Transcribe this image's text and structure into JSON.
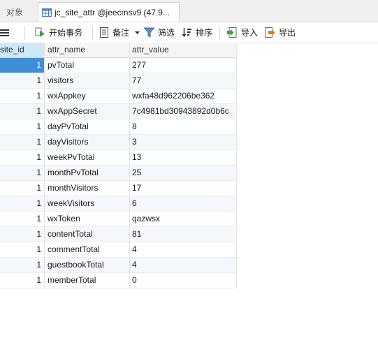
{
  "tabs": {
    "objects_label": "对象",
    "active_label": "jc_site_attr @jeecmsv9 (47.9..."
  },
  "toolbar": {
    "begin_transaction": "开始事务",
    "memo": "备注",
    "filter": "筛选",
    "sort": "排序",
    "import": "导入",
    "export": "导出"
  },
  "table": {
    "columns": [
      "site_id",
      "attr_name",
      "attr_value"
    ],
    "rows": [
      {
        "site_id": "1",
        "attr_name": "pvTotal",
        "attr_value": "277"
      },
      {
        "site_id": "1",
        "attr_name": "visitors",
        "attr_value": "77"
      },
      {
        "site_id": "1",
        "attr_name": "wxAppkey",
        "attr_value": "wxfa48d962206be362"
      },
      {
        "site_id": "1",
        "attr_name": "wxAppSecret",
        "attr_value": "7c4981bd30943892d0b6c"
      },
      {
        "site_id": "1",
        "attr_name": "dayPvTotal",
        "attr_value": "8"
      },
      {
        "site_id": "1",
        "attr_name": "dayVisitors",
        "attr_value": "3"
      },
      {
        "site_id": "1",
        "attr_name": "weekPvTotal",
        "attr_value": "13"
      },
      {
        "site_id": "1",
        "attr_name": "monthPvTotal",
        "attr_value": "25"
      },
      {
        "site_id": "1",
        "attr_name": "monthVisitors",
        "attr_value": "17"
      },
      {
        "site_id": "1",
        "attr_name": "weekVisitors",
        "attr_value": "6"
      },
      {
        "site_id": "1",
        "attr_name": "wxToken",
        "attr_value": "qazwsx"
      },
      {
        "site_id": "1",
        "attr_name": "contentTotal",
        "attr_value": "81"
      },
      {
        "site_id": "1",
        "attr_name": "commentTotal",
        "attr_value": "4"
      },
      {
        "site_id": "1",
        "attr_name": "guestbookTotal",
        "attr_value": "4"
      },
      {
        "site_id": "1",
        "attr_name": "memberTotal",
        "attr_value": "0"
      }
    ],
    "selected_row": 0
  },
  "colors": {
    "selection": "#3f8fd8",
    "header_selected": "#cfe8f7",
    "row_alt": "#f4f7fb"
  }
}
